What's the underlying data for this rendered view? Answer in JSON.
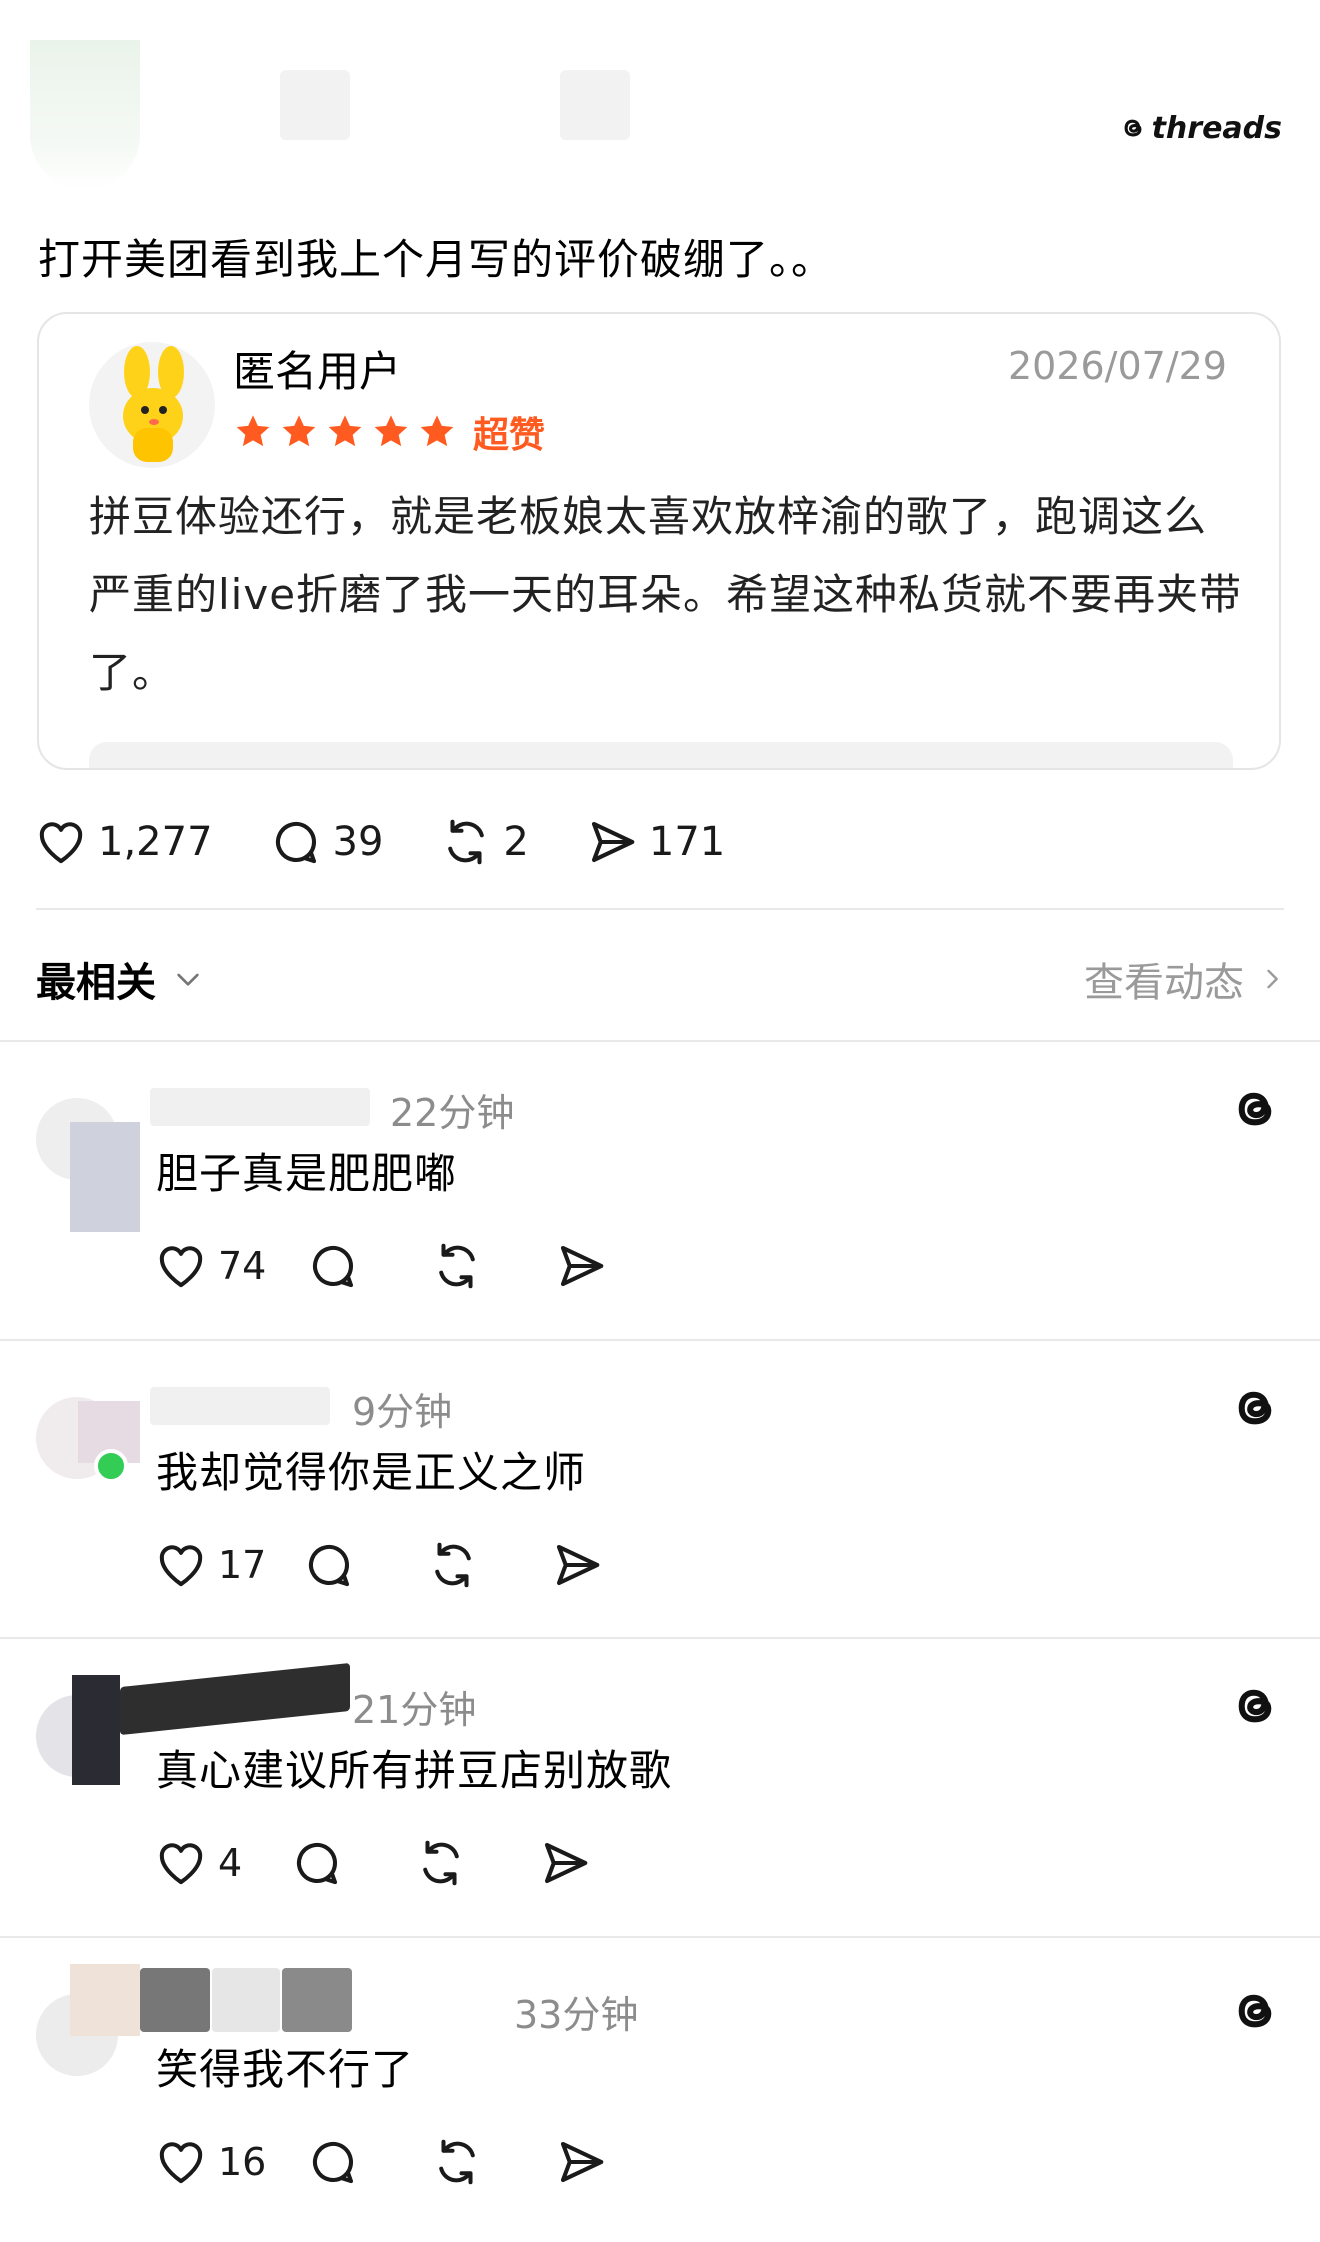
{
  "brand": "threads",
  "post": {
    "text": "打开美团看到我上个月写的评价破绷了。。",
    "review": {
      "user": "匿名用户",
      "date": "2026/07/29",
      "rating_label": "超赞",
      "stars": 5,
      "body": "拼豆体验还行，就是老板娘太喜欢放梓渝的歌了，跑调这么严重的live折磨了我一天的耳朵。希望这种私货就不要再夹带了。"
    },
    "stats": {
      "likes": "1,277",
      "comments": "39",
      "reposts": "2",
      "shares": "171"
    }
  },
  "sort": {
    "label": "最相关",
    "view_activity": "查看动态"
  },
  "comments": [
    {
      "time": "22分钟",
      "text": "胆子真是肥肥嘟",
      "likes": "74"
    },
    {
      "time": "9分钟",
      "text": "我却觉得你是正义之师",
      "likes": "17"
    },
    {
      "time": "21分钟",
      "text": "真心建议所有拼豆店别放歌",
      "likes": "4"
    },
    {
      "time": "33分钟",
      "text": "笑得我不行了",
      "likes": "16"
    }
  ],
  "colors": {
    "star": "#ff5a1f",
    "muted": "#9a9a9a",
    "online": "#33cc55"
  }
}
